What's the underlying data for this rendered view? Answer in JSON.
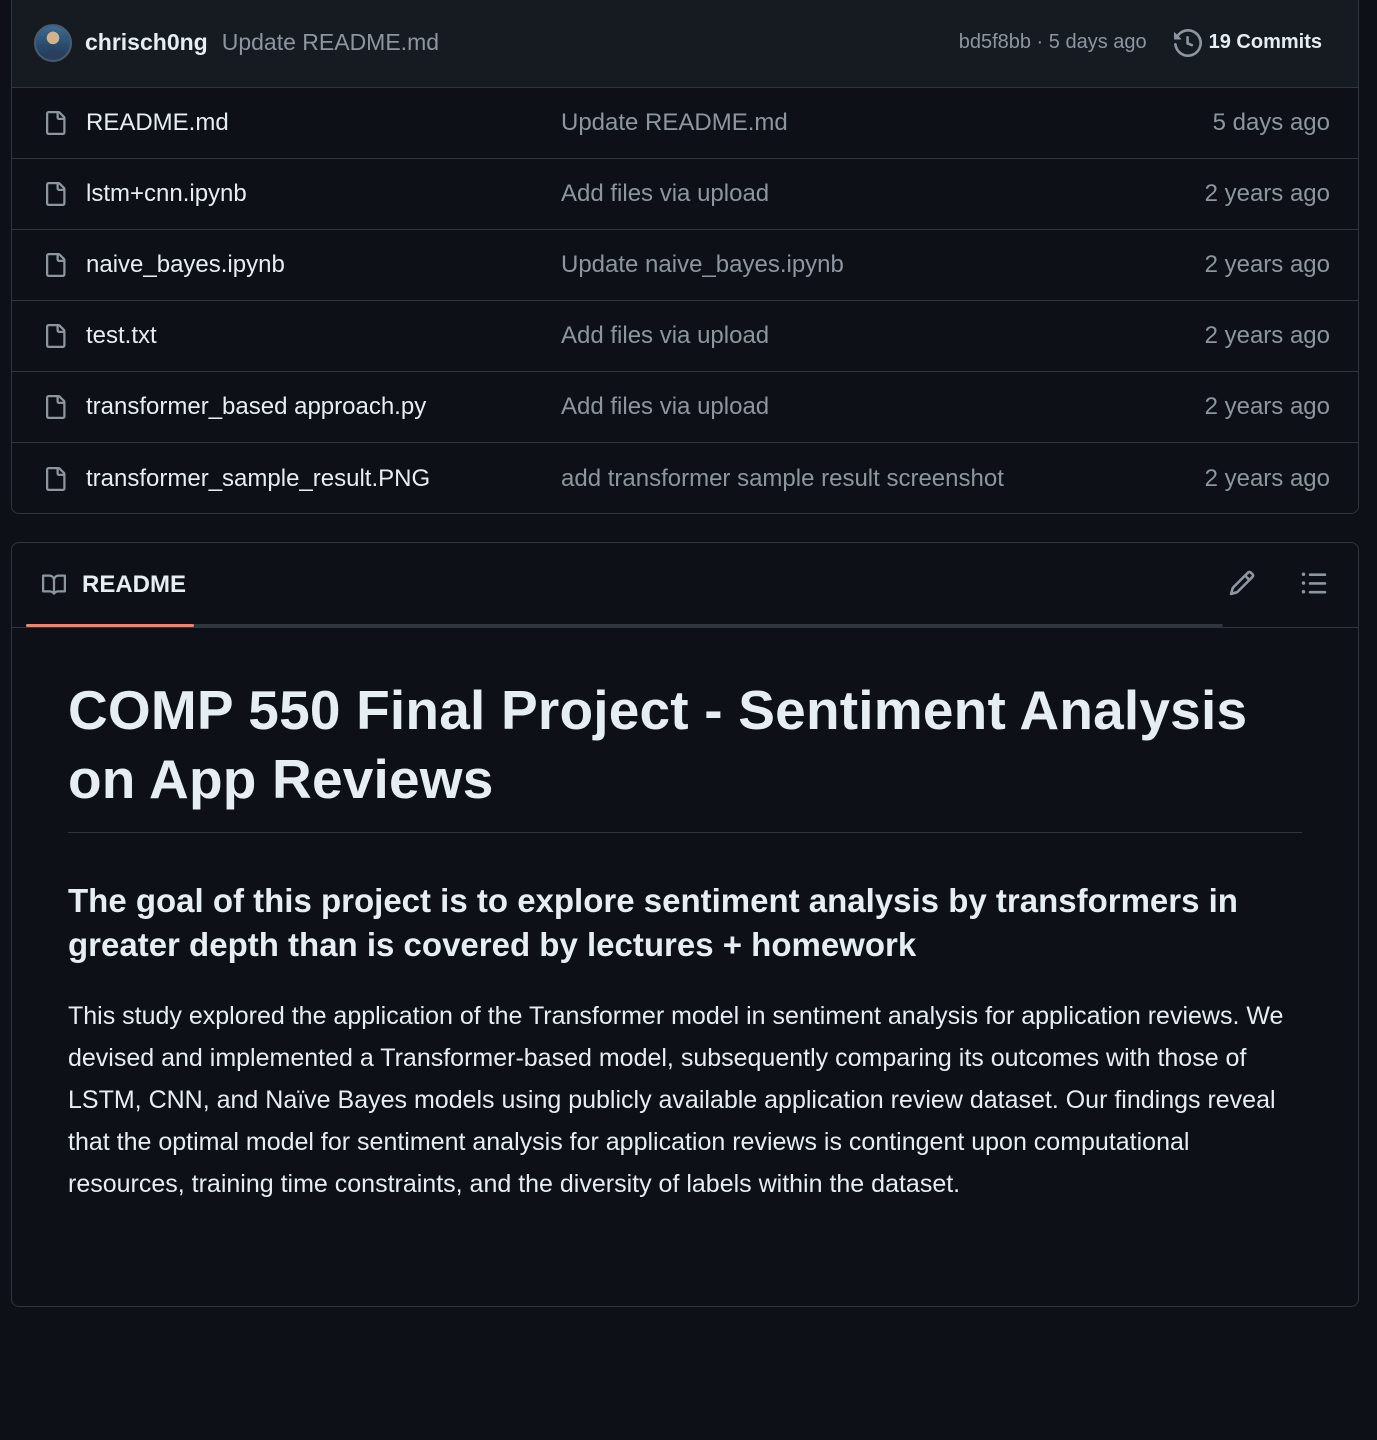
{
  "commit_bar": {
    "author": "chrisch0ng",
    "message": "Update README.md",
    "meta": "bd5f8bb · 5 days ago",
    "commits_label": "19 Commits"
  },
  "files": [
    {
      "name": "README.md",
      "message": "Update README.md",
      "age": "5 days ago"
    },
    {
      "name": "lstm+cnn.ipynb",
      "message": "Add files via upload",
      "age": "2 years ago"
    },
    {
      "name": "naive_bayes.ipynb",
      "message": "Update naive_bayes.ipynb",
      "age": "2 years ago"
    },
    {
      "name": "test.txt",
      "message": "Add files via upload",
      "age": "2 years ago"
    },
    {
      "name": "transformer_based approach.py",
      "message": "Add files via upload",
      "age": "2 years ago"
    },
    {
      "name": "transformer_sample_result.PNG",
      "message": "add transformer sample result screenshot",
      "age": "2 years ago"
    }
  ],
  "readme": {
    "tab_label": "README",
    "title": "COMP 550 Final Project - Sentiment Analysis on App Reviews",
    "subtitle": "The goal of this project is to explore sentiment analysis by transformers in greater depth than is covered by lectures + homework",
    "paragraph": "This study explored the application of the Transformer model in sentiment analysis for application reviews. We devised and implemented a Transformer-based model, subsequently comparing its outcomes with those of LSTM, CNN, and Naïve Bayes models using publicly available application review dataset. Our findings reveal that the optimal model for sentiment analysis for application reviews is contingent upon computational resources, training time constraints, and the diversity of labels within the dataset."
  },
  "icons": {
    "file": "file-icon",
    "history": "history-icon",
    "book": "book-icon",
    "edit": "pencil-icon",
    "outline": "list-icon"
  },
  "colors": {
    "background": "#0d1117",
    "header_background": "#161b22",
    "border": "#30363d",
    "muted_text": "#8d96a0",
    "primary_text": "#e6edf3",
    "tab_accent": "#f78166"
  }
}
